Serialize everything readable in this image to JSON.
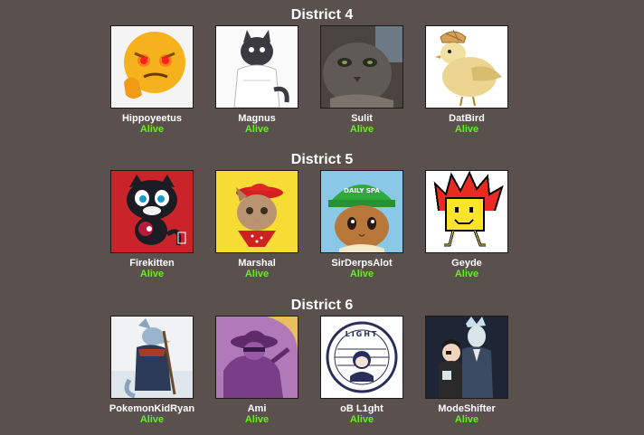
{
  "status_color": "#66ee22",
  "districts": [
    {
      "title": "District 4",
      "tributes": [
        {
          "name": "Hippoyeetus",
          "status": "Alive",
          "avatar": "angry-emoji-avatar"
        },
        {
          "name": "Magnus",
          "status": "Alive",
          "avatar": "cartoon-dog-avatar"
        },
        {
          "name": "Sulit",
          "status": "Alive",
          "avatar": "gray-cat-photo-avatar"
        },
        {
          "name": "DatBird",
          "status": "Alive",
          "avatar": "bird-with-hat-avatar"
        }
      ]
    },
    {
      "title": "District 5",
      "tributes": [
        {
          "name": "Firekitten",
          "status": "Alive",
          "avatar": "black-cat-mascot-avatar"
        },
        {
          "name": "Marshal",
          "status": "Alive",
          "avatar": "cowboy-cat-avatar"
        },
        {
          "name": "SirDerpsAlot",
          "status": "Alive",
          "avatar": "eevee-with-cap-avatar"
        },
        {
          "name": "Geyde",
          "status": "Alive",
          "avatar": "pixel-flame-avatar"
        }
      ]
    },
    {
      "title": "District 6",
      "tributes": [
        {
          "name": "PokemonKidRyan",
          "status": "Alive",
          "avatar": "wolf-warrior-avatar"
        },
        {
          "name": "Ami",
          "status": "Alive",
          "avatar": "purple-silhouette-avatar"
        },
        {
          "name": "oB L1ght",
          "status": "Alive",
          "avatar": "light-badge-avatar"
        },
        {
          "name": "ModeShifter",
          "status": "Alive",
          "avatar": "anime-duo-avatar"
        }
      ]
    }
  ]
}
